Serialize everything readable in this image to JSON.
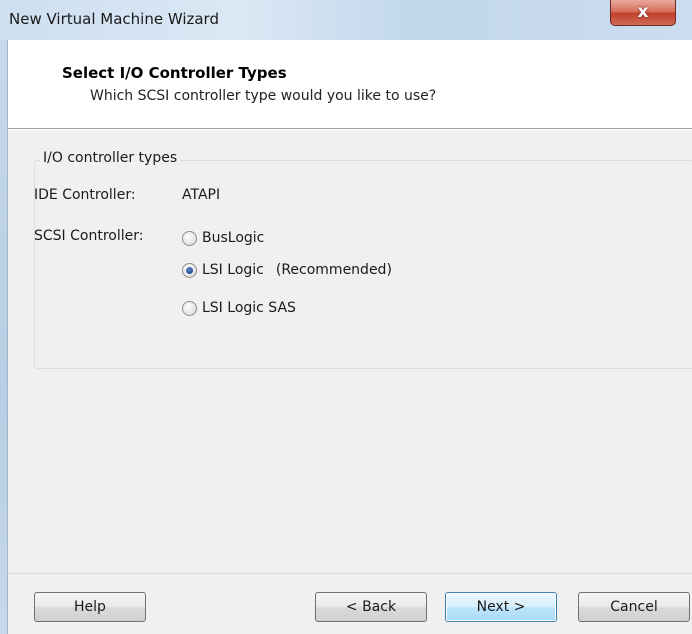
{
  "window": {
    "title": "New Virtual Machine Wizard",
    "close_glyph": "x"
  },
  "header": {
    "title": "Select I/O Controller Types",
    "subtitle": "Which SCSI controller type would you like to use?"
  },
  "group": {
    "legend": "I/O controller types",
    "ide": {
      "label": "IDE Controller:",
      "value": "ATAPI"
    },
    "scsi": {
      "label": "SCSI Controller:",
      "options": [
        {
          "label": "BusLogic",
          "checked": false,
          "note": ""
        },
        {
          "label": "LSI Logic",
          "checked": true,
          "note": "(Recommended)"
        },
        {
          "label": "LSI Logic SAS",
          "checked": false,
          "note": ""
        }
      ]
    }
  },
  "buttons": {
    "help": "Help",
    "back": "< Back",
    "next": "Next >",
    "cancel": "Cancel"
  },
  "colors": {
    "accent": "#3c7fb1",
    "close": "#c2402a"
  }
}
